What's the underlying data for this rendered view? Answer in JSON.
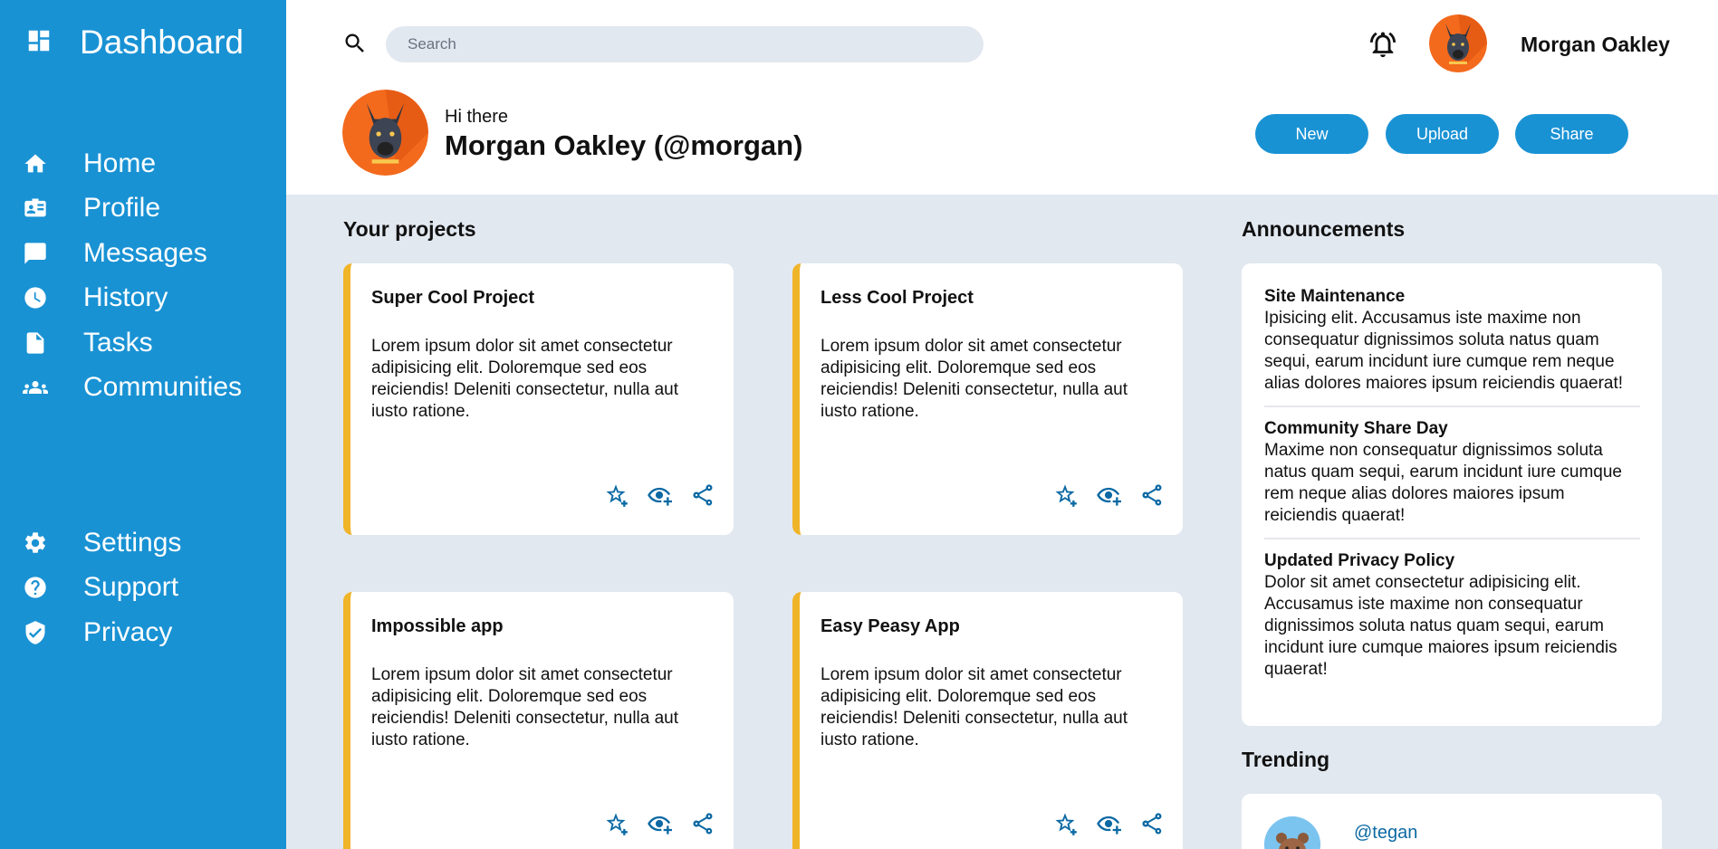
{
  "sidebar": {
    "brand": {
      "title": "Dashboard",
      "icon": "dashboard-icon"
    },
    "nav_main": [
      {
        "label": "Home",
        "icon": "home-icon"
      },
      {
        "label": "Profile",
        "icon": "id-card-icon"
      },
      {
        "label": "Messages",
        "icon": "chat-icon"
      },
      {
        "label": "History",
        "icon": "clock-icon"
      },
      {
        "label": "Tasks",
        "icon": "document-icon"
      },
      {
        "label": "Communities",
        "icon": "people-icon"
      }
    ],
    "nav_secondary": [
      {
        "label": "Settings",
        "icon": "gear-icon"
      },
      {
        "label": "Support",
        "icon": "help-icon"
      },
      {
        "label": "Privacy",
        "icon": "shield-icon"
      }
    ]
  },
  "header": {
    "search": {
      "placeholder": "Search"
    },
    "user_name": "Morgan Oakley",
    "greeting": "Hi there",
    "profile_name": "Morgan Oakley (@morgan)",
    "buttons": {
      "new": "New",
      "upload": "Upload",
      "share": "Share"
    }
  },
  "projects": {
    "title": "Your projects",
    "cards": [
      {
        "title": "Super Cool Project",
        "body": "Lorem ipsum dolor sit amet consectetur adipisicing elit. Doloremque sed eos reiciendis! Deleniti consectetur, nulla aut iusto ratione."
      },
      {
        "title": "Less Cool Project",
        "body": "Lorem ipsum dolor sit amet consectetur adipisicing elit. Doloremque sed eos reiciendis! Deleniti consectetur, nulla aut iusto ratione."
      },
      {
        "title": "Impossible app",
        "body": "Lorem ipsum dolor sit amet consectetur adipisicing elit. Doloremque sed eos reiciendis! Deleniti consectetur, nulla aut iusto ratione."
      },
      {
        "title": "Easy Peasy App",
        "body": "Lorem ipsum dolor sit amet consectetur adipisicing elit. Doloremque sed eos reiciendis! Deleniti consectetur, nulla aut iusto ratione."
      }
    ]
  },
  "announcements": {
    "title": "Announcements",
    "items": [
      {
        "title": "Site Maintenance",
        "text": "Ipisicing elit. Accusamus iste maxime non consequatur dignissimos soluta natus quam sequi, earum incidunt iure cumque rem neque alias dolores maiores ipsum reiciendis quaerat!"
      },
      {
        "title": "Community Share Day",
        "text": "Maxime non consequatur dignissimos soluta natus quam sequi, earum incidunt iure cumque rem neque alias dolores maiores ipsum reiciendis quaerat!"
      },
      {
        "title": "Updated Privacy Policy",
        "text": "Dolor sit amet consectetur adipisicing elit. Accusamus iste maxime non consequatur dignissimos soluta natus quam sequi, earum incidunt iure cumque maiores ipsum reiciendis quaerat!"
      }
    ]
  },
  "trending": {
    "title": "Trending",
    "items": [
      {
        "handle": "@tegan"
      }
    ]
  },
  "colors": {
    "sidebar": "#1992d4",
    "accent_border": "#f0b429",
    "background": "#e2e8f0",
    "icon_blue": "#0b69a3"
  }
}
